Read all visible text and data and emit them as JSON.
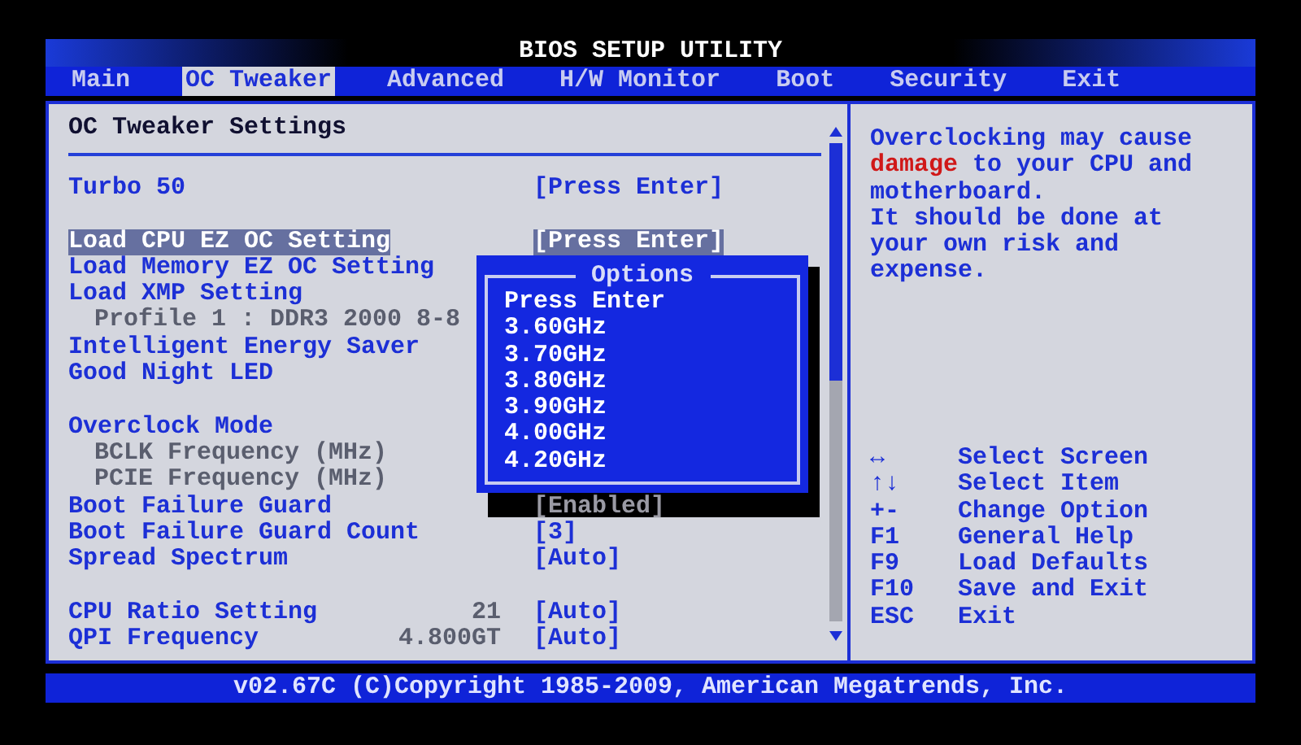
{
  "window": {
    "title": "BIOS SETUP UTILITY"
  },
  "tabs": [
    {
      "label": "Main",
      "selected": false
    },
    {
      "label": "OC Tweaker",
      "selected": true
    },
    {
      "label": "Advanced",
      "selected": false
    },
    {
      "label": "H/W Monitor",
      "selected": false
    },
    {
      "label": "Boot",
      "selected": false
    },
    {
      "label": "Security",
      "selected": false
    },
    {
      "label": "Exit",
      "selected": false
    }
  ],
  "settings": {
    "title": "OC Tweaker Settings",
    "rows": [
      {
        "kind": "item",
        "label": "Turbo 50",
        "value": "[Press Enter]",
        "selected": false
      },
      {
        "kind": "gap"
      },
      {
        "kind": "item",
        "label": "Load CPU EZ OC Setting",
        "value": "[Press Enter]",
        "selected": true
      },
      {
        "kind": "item",
        "label": "Load Memory EZ OC Setting",
        "selected": false
      },
      {
        "kind": "item",
        "label": "Load XMP Setting",
        "selected": false
      },
      {
        "kind": "sub",
        "label": "Profile 1 : DDR3 2000 8-8",
        "selected": false
      },
      {
        "kind": "item",
        "label": "Intelligent Energy Saver",
        "selected": false
      },
      {
        "kind": "item",
        "label": "Good Night LED",
        "selected": false
      },
      {
        "kind": "gap"
      },
      {
        "kind": "item",
        "label": "Overclock Mode",
        "selected": false
      },
      {
        "kind": "sub",
        "label": "BCLK Frequency (MHz)",
        "selected": false
      },
      {
        "kind": "sub",
        "label": "PCIE Frequency (MHz)",
        "selected": false
      },
      {
        "kind": "item",
        "label": "Boot Failure Guard",
        "value": "[Enabled]",
        "shaded": true,
        "selected": false
      },
      {
        "kind": "item",
        "label": "Boot Failure Guard Count",
        "value": "[3]",
        "selected": false
      },
      {
        "kind": "item",
        "label": "Spread Spectrum",
        "value": "[Auto]",
        "selected": false
      },
      {
        "kind": "gap"
      },
      {
        "kind": "item",
        "label": "CPU Ratio Setting",
        "reading": "21",
        "value": "[Auto]",
        "selected": false
      },
      {
        "kind": "item",
        "label": "QPI Frequency",
        "reading": "4.800GT",
        "value": "[Auto]",
        "selected": false
      }
    ]
  },
  "options_popup": {
    "title": "Options",
    "options": [
      "Press Enter",
      "3.60GHz",
      "3.70GHz",
      "3.80GHz",
      "3.90GHz",
      "4.00GHz",
      "4.20GHz"
    ]
  },
  "help": {
    "lines": [
      [
        {
          "text": "Overclocking may cause"
        }
      ],
      [
        {
          "text": "damage",
          "warning": true
        },
        {
          "text": " to your CPU and"
        }
      ],
      [
        {
          "text": "motherboard."
        }
      ],
      [
        {
          "text": "It should be done at"
        }
      ],
      [
        {
          "text": "your own risk and"
        }
      ],
      [
        {
          "text": "expense."
        }
      ]
    ]
  },
  "keys": [
    {
      "key": "↔",
      "action": "Select Screen"
    },
    {
      "key": "↑↓",
      "action": "Select Item"
    },
    {
      "key": "+-",
      "action": "Change Option"
    },
    {
      "key": "F1",
      "action": "General Help"
    },
    {
      "key": "F9",
      "action": "Load Defaults"
    },
    {
      "key": "F10",
      "action": "Save and Exit"
    },
    {
      "key": "ESC",
      "action": "Exit"
    }
  ],
  "status_bar": "v02.67C (C)Copyright 1985-2009, American Megatrends, Inc."
}
